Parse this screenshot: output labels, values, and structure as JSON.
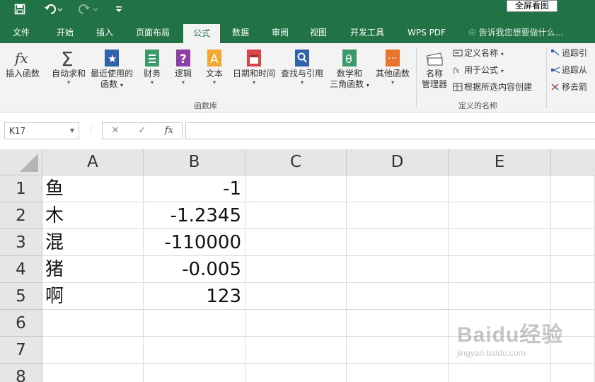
{
  "quick_access": {
    "save_icon": "save-icon",
    "undo_icon": "undo-icon",
    "redo_icon": "redo-icon",
    "customize_icon": "customize-qat-icon"
  },
  "fullscreen_tip": "全屏看图",
  "tabs": [
    "文件",
    "开始",
    "插入",
    "页面布局",
    "公式",
    "数据",
    "审阅",
    "视图",
    "开发工具",
    "WPS PDF"
  ],
  "active_tab": "公式",
  "tell_me": "告诉我您想要做什么...",
  "ribbon": {
    "insert_function": "插入函数",
    "autosum": "自动求和",
    "recent_1": "最近使用的",
    "recent_2": "函数",
    "financial": "财务",
    "logical": "逻辑",
    "text": "文本",
    "datetime": "日期和时间",
    "lookup": "查找与引用",
    "math_1": "数学和",
    "math_2": "三角函数",
    "more": "其他函数",
    "library_group": "函数库",
    "name_mgr_1": "名称",
    "name_mgr_2": "管理器",
    "define_name": "定义名称",
    "use_in_formula": "用于公式",
    "create_from_sel": "根据所选内容创建",
    "names_group": "定义的名称",
    "trace_precedents": "追踪引",
    "trace_dependents": "追踪从",
    "remove_arrows": "移去箭"
  },
  "formula_bar": {
    "name_box": "K17",
    "cancel": "✕",
    "enter": "✓",
    "fx": "fx",
    "value": ""
  },
  "columns": [
    "A",
    "B",
    "C",
    "D",
    "E"
  ],
  "rows": [
    {
      "num": "1",
      "a": "鱼",
      "b": "-1"
    },
    {
      "num": "2",
      "a": "木",
      "b": "-1.2345"
    },
    {
      "num": "3",
      "a": "混",
      "b": "-110000"
    },
    {
      "num": "4",
      "a": "猪",
      "b": "-0.005"
    },
    {
      "num": "5",
      "a": "啊",
      "b": "123"
    },
    {
      "num": "6",
      "a": "",
      "b": ""
    },
    {
      "num": "7",
      "a": "",
      "b": ""
    },
    {
      "num": "8",
      "a": "",
      "b": ""
    }
  ],
  "watermark": {
    "brand": "Baidu经验",
    "url": "jingyan.baidu.com"
  },
  "colors": {
    "excel_green": "#217346",
    "ribbon_bg": "#f3f3f3",
    "header_bg": "#e6e6e6"
  }
}
